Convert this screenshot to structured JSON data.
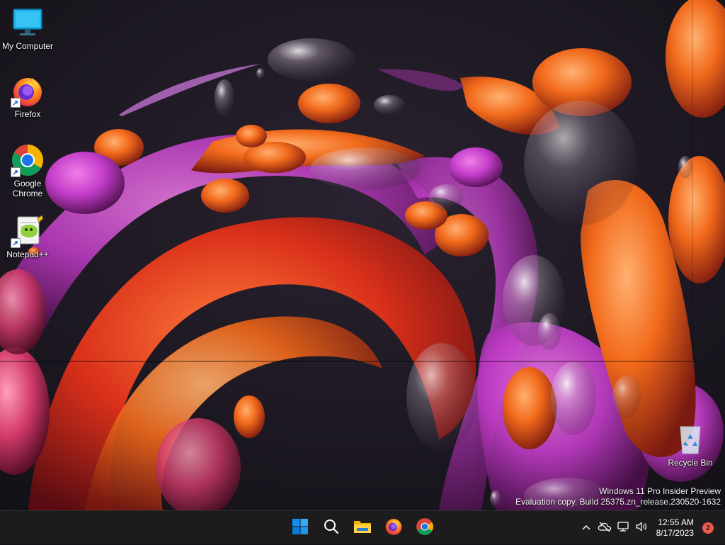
{
  "desktop": {
    "icons": [
      {
        "label": "My Computer",
        "icon": "monitor-icon",
        "shortcut": false
      },
      {
        "label": "Firefox",
        "icon": "firefox-icon",
        "shortcut": true
      },
      {
        "label": "Google Chrome",
        "icon": "chrome-icon",
        "shortcut": true
      },
      {
        "label": "Notepad++",
        "icon": "notepadpp-icon",
        "shortcut": true
      },
      {
        "label": "Recycle Bin",
        "icon": "recycle-bin-icon",
        "shortcut": false
      }
    ]
  },
  "watermark": {
    "line1": "Windows 11 Pro Insider Preview",
    "line2": "Evaluation copy. Build 25375.zn_release.230520-1632"
  },
  "taskbar": {
    "pinned": [
      {
        "name": "start",
        "icon": "windows-start-icon"
      },
      {
        "name": "search",
        "icon": "search-icon"
      },
      {
        "name": "file-explorer",
        "icon": "folder-icon"
      },
      {
        "name": "firefox",
        "icon": "firefox-icon"
      },
      {
        "name": "chrome",
        "icon": "chrome-icon"
      }
    ],
    "tray": {
      "time": "12:55 AM",
      "date": "8/17/2023",
      "notification_count": "2"
    }
  },
  "colors": {
    "taskbar": "#1c1c1c",
    "start_blue": "#0f8ff2",
    "badge": "#ee5a4d",
    "wallpaper_orange": "#f26a1b",
    "wallpaper_magenta": "#c23cc8"
  }
}
